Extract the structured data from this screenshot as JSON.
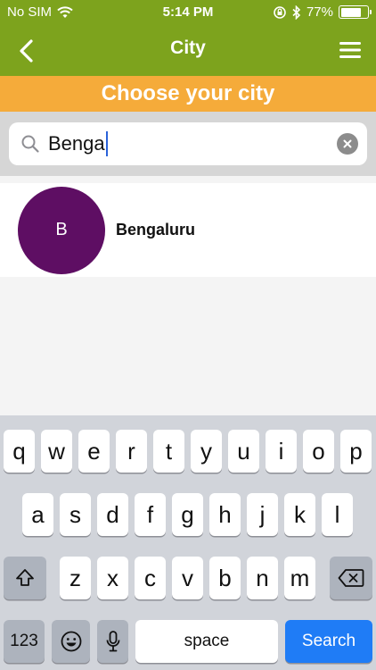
{
  "status_bar": {
    "carrier": "No SIM",
    "time": "5:14 PM",
    "battery_percent": "77%",
    "battery_level": 0.77
  },
  "nav": {
    "title": "City",
    "back_icon": "chevron-left-icon",
    "menu_icon": "hamburger-menu-icon"
  },
  "banner": {
    "text": "Choose your city"
  },
  "search": {
    "value": "Benga",
    "icon": "search-icon",
    "clear_icon": "clear-icon"
  },
  "results": [
    {
      "initial": "B",
      "name": "Bengaluru"
    }
  ],
  "keyboard": {
    "row1": [
      "q",
      "w",
      "e",
      "r",
      "t",
      "y",
      "u",
      "i",
      "o",
      "p"
    ],
    "row2": [
      "a",
      "s",
      "d",
      "f",
      "g",
      "h",
      "j",
      "k",
      "l"
    ],
    "row3": [
      "z",
      "x",
      "c",
      "v",
      "b",
      "n",
      "m"
    ],
    "numbers_label": "123",
    "space_label": "space",
    "search_label": "Search"
  },
  "colors": {
    "header": "#7da31d",
    "banner": "#f5ab3a",
    "avatar": "#5e0e63",
    "search_key": "#1f7cf6"
  }
}
